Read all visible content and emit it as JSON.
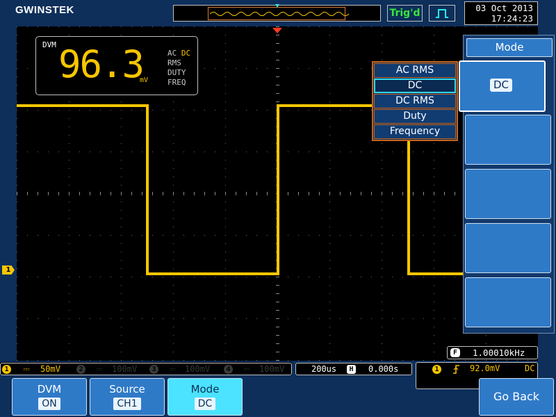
{
  "brand": "GWINSTEK",
  "header": {
    "trigger_status": "Trig'd",
    "date": "03 Oct 2013",
    "time": "17:24:23"
  },
  "dvm": {
    "title": "DVM",
    "value": "96.3",
    "unit": "mV",
    "modes_line1_ac": "AC",
    "modes_line1_dc": "DC",
    "mode_rms": "RMS",
    "mode_duty": "DUTY",
    "mode_freq": "FREQ"
  },
  "dropdown": {
    "items": [
      "AC RMS",
      "DC",
      "DC RMS",
      "Duty",
      "Frequency"
    ],
    "selected_index": 1
  },
  "side_menu": {
    "title": "Mode",
    "button1_value": "DC"
  },
  "channels": [
    {
      "num": "1",
      "scale": "50mV",
      "color": "#f7c600",
      "coupling": "⎓"
    },
    {
      "num": "2",
      "scale": "100mV",
      "color": "#3a3a3a",
      "coupling": "⎓"
    },
    {
      "num": "3",
      "scale": "100mV",
      "color": "#3a3a3a",
      "coupling": "⎓"
    },
    {
      "num": "4",
      "scale": "100mV",
      "color": "#3a3a3a",
      "coupling": "⎓"
    }
  ],
  "timebase": {
    "scale": "200us",
    "mode_icon": "H",
    "position": "0.000s"
  },
  "trigger": {
    "source": "1",
    "slope_icon": "rising-edge",
    "level": "92.0mV",
    "coupling": "DC"
  },
  "frequency": {
    "label": "F",
    "value": "1.00010kHz"
  },
  "bottom_menu": [
    {
      "title": "DVM",
      "value": "ON"
    },
    {
      "title": "Source",
      "value": "CH1"
    },
    {
      "title": "Mode",
      "value": "DC"
    }
  ],
  "go_back": "Go Back",
  "colors": {
    "trace": "#f7c600",
    "accent_blue": "#2f7ac7",
    "highlight": "#34d8e8",
    "background": "#0d2f5a"
  }
}
